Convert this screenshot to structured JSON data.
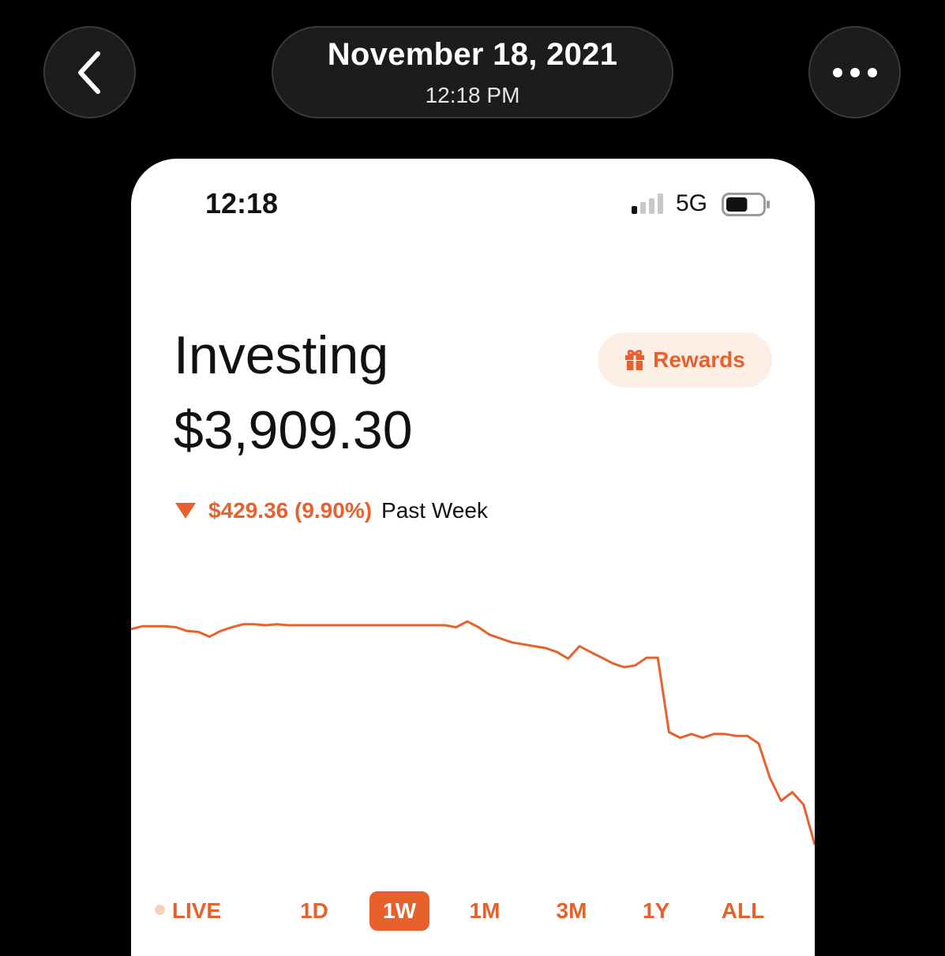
{
  "header": {
    "date": "November 18, 2021",
    "time": "12:18 PM",
    "back_icon": "chevron-left-icon",
    "more_icon": "ellipsis-icon"
  },
  "status_bar": {
    "time": "12:18",
    "network": "5G",
    "signal_bars_active": 1,
    "battery_level": 0.6
  },
  "page": {
    "title": "Investing",
    "balance": "$3,909.30",
    "rewards_label": "Rewards",
    "rewards_icon": "gift-icon",
    "change_value": "$429.36 (9.90%)",
    "change_period": "Past Week",
    "change_direction": "down"
  },
  "colors": {
    "accent": "#e8612c",
    "accent_light": "#fdeee6",
    "background": "#000000",
    "card": "#ffffff"
  },
  "range_tabs": [
    {
      "label": "LIVE",
      "active": false
    },
    {
      "label": "1D",
      "active": false
    },
    {
      "label": "1W",
      "active": true
    },
    {
      "label": "1M",
      "active": false
    },
    {
      "label": "3M",
      "active": false
    },
    {
      "label": "1Y",
      "active": false
    },
    {
      "label": "ALL",
      "active": false
    }
  ],
  "chart_data": {
    "type": "line",
    "title": "",
    "xlabel": "",
    "ylabel": "",
    "grid": false,
    "legend": "none",
    "color": "#e8612c",
    "y": [
      4336,
      4339,
      4339,
      4339,
      4338,
      4334,
      4333,
      4328,
      4334,
      4338,
      4341,
      4341,
      4340,
      4341,
      4340,
      4340,
      4340,
      4340,
      4340,
      4340,
      4340,
      4340,
      4340,
      4340,
      4340,
      4340,
      4340,
      4340,
      4340,
      4338,
      4344,
      4338,
      4330,
      4326,
      4322,
      4320,
      4318,
      4316,
      4312,
      4305,
      4318,
      4312,
      4306,
      4300,
      4296,
      4298,
      4306,
      4306,
      4228,
      4222,
      4226,
      4222,
      4226,
      4226,
      4224,
      4224,
      4216,
      4180,
      4156,
      4165,
      4152,
      4110
    ]
  }
}
